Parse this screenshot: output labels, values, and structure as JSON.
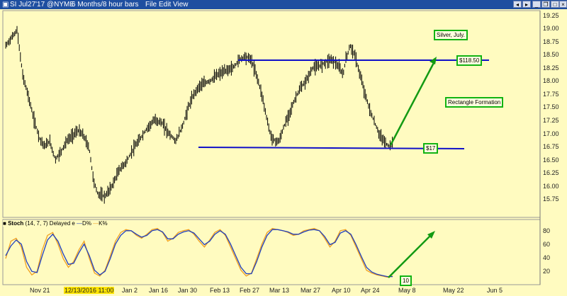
{
  "window": {
    "symbol": "SI Jul27'17 @NYME",
    "period": "6 Months/8 hour bars",
    "menu": [
      "File",
      "Edit",
      "View"
    ]
  },
  "colors": {
    "background": "#fffbc0",
    "bars": "#000000",
    "resistance": "#1010c8",
    "arrow": "#139a13",
    "stoch_d": "#1f3fbf",
    "stoch_k": "#f0a020",
    "annot_border": "#12b312"
  },
  "price_axis": {
    "ticks": [
      "19.25",
      "19.00",
      "18.75",
      "18.50",
      "18.25",
      "18.00",
      "17.75",
      "17.50",
      "17.25",
      "17.00",
      "16.75",
      "16.50",
      "16.25",
      "16.00",
      "15.75"
    ]
  },
  "stoch_axis": {
    "ticks": [
      "80",
      "60",
      "40",
      "20"
    ]
  },
  "date_axis": {
    "labels": [
      "Nov 21",
      "12/13/2016 11:00",
      "Jan 2",
      "Jan 16",
      "Jan 30",
      "Feb 13",
      "Feb 27",
      "Mar 13",
      "Mar 27",
      "Apr 10",
      "Apr 24",
      "May 8",
      "May 22",
      "Jun 5"
    ],
    "highlighted": "12/13/2016 11:00"
  },
  "annotations": {
    "silver": "Silver, July.",
    "top": "$118.50",
    "rect": "Rectangle Formation",
    "bottom": "$17",
    "stoch_val": "10"
  },
  "stoch": {
    "header_prefix": "Stoch",
    "params": "(14, 7, 7) Delayed e",
    "d_label": "D%",
    "k_label": "K%"
  },
  "chart_data": {
    "type": "line",
    "ylim": [
      15.6,
      19.35
    ],
    "resistance": 18.5,
    "support": 16.88,
    "price_x": [
      0,
      8,
      16,
      24,
      32,
      40,
      48,
      55,
      62,
      70,
      78,
      86,
      94,
      102,
      110,
      118,
      124,
      130,
      140,
      150,
      160,
      170,
      180,
      190,
      200,
      210,
      220,
      230,
      240,
      250,
      258,
      266,
      274,
      282,
      290,
      298,
      306,
      314,
      322,
      330,
      338,
      346,
      354,
      362,
      368,
      374,
      380,
      386,
      392,
      398,
      404,
      410,
      416,
      422,
      428,
      434,
      440,
      446,
      452,
      458,
      464,
      470,
      476,
      480,
      486,
      492,
      498,
      504,
      510,
      516,
      522,
      528,
      534,
      540,
      546
    ],
    "price_y": [
      18.75,
      18.9,
      19.05,
      18.2,
      17.8,
      17.35,
      17.0,
      16.85,
      16.95,
      16.6,
      16.75,
      16.95,
      17.05,
      17.15,
      17.05,
      16.8,
      16.2,
      15.95,
      15.9,
      16.1,
      16.4,
      16.55,
      16.8,
      17.0,
      17.2,
      17.35,
      17.3,
      17.1,
      16.95,
      17.25,
      17.6,
      17.85,
      18.0,
      18.05,
      18.1,
      18.2,
      18.25,
      18.3,
      18.35,
      18.5,
      18.55,
      18.5,
      18.2,
      17.8,
      17.4,
      17.05,
      16.95,
      16.95,
      17.2,
      17.4,
      17.6,
      17.8,
      17.95,
      18.05,
      18.2,
      18.35,
      18.35,
      18.4,
      18.45,
      18.5,
      18.45,
      18.35,
      18.2,
      18.5,
      18.75,
      18.6,
      18.3,
      18.0,
      17.7,
      17.45,
      17.25,
      17.05,
      16.95,
      16.85,
      16.9
    ],
    "stoch_k": [
      40,
      70,
      75,
      60,
      25,
      12,
      18,
      55,
      80,
      85,
      65,
      40,
      25,
      35,
      55,
      70,
      40,
      15,
      10,
      20,
      45,
      70,
      85,
      90,
      88,
      80,
      75,
      82,
      90,
      92,
      85,
      70,
      75,
      85,
      88,
      90,
      82,
      70,
      60,
      72,
      85,
      90,
      80,
      60,
      40,
      20,
      10,
      15,
      40,
      65,
      85,
      92,
      90,
      88,
      85,
      80,
      82,
      88,
      90,
      92,
      88,
      75,
      60,
      70,
      88,
      90,
      80,
      60,
      40,
      20,
      15,
      12,
      10,
      8,
      10
    ],
    "stoch_d": [
      45,
      62,
      72,
      65,
      35,
      18,
      16,
      45,
      72,
      82,
      70,
      48,
      30,
      32,
      50,
      65,
      45,
      20,
      12,
      18,
      40,
      65,
      80,
      88,
      88,
      82,
      77,
      80,
      88,
      90,
      86,
      74,
      74,
      82,
      86,
      88,
      84,
      74,
      64,
      70,
      82,
      88,
      82,
      65,
      45,
      25,
      14,
      14,
      35,
      60,
      80,
      90,
      90,
      88,
      86,
      82,
      82,
      86,
      89,
      90,
      88,
      78,
      64,
      68,
      84,
      88,
      82,
      64,
      44,
      25,
      17,
      13,
      11,
      9,
      9
    ]
  }
}
